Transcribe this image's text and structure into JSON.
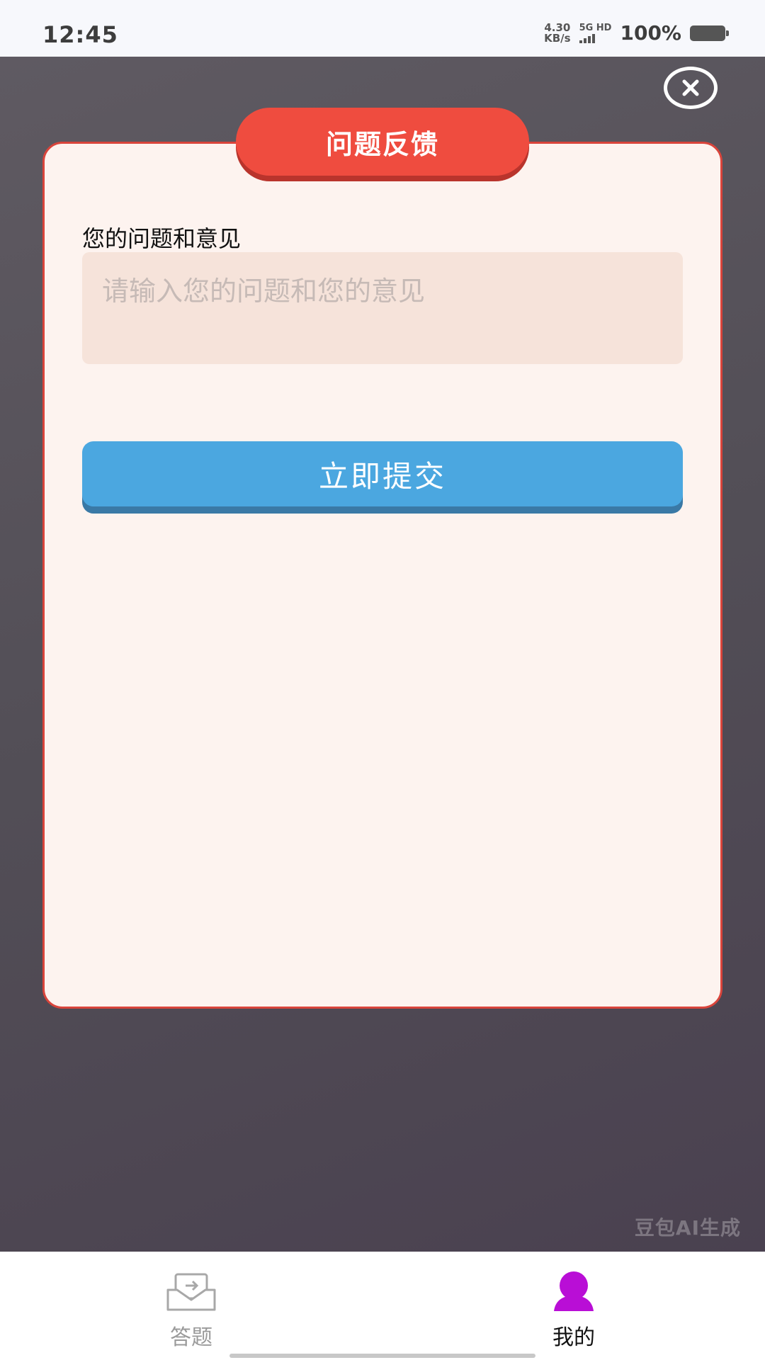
{
  "status_bar": {
    "time": "12:45",
    "speed_value": "4.30",
    "speed_unit": "KB/s",
    "network_top": "5G HD",
    "battery": "100%"
  },
  "dialog": {
    "title": "问题反馈",
    "field_label": "您的问题和意见",
    "input_placeholder": "请输入您的问题和您的意见",
    "input_value": "",
    "submit_label": "立即提交"
  },
  "watermark": "豆包AI生成",
  "tab_bar": {
    "items": [
      {
        "label": "答题",
        "icon": "mail-tray-icon",
        "active": false
      },
      {
        "label": "我的",
        "icon": "user-icon",
        "active": true
      }
    ]
  },
  "colors": {
    "title_tab": "#ef4c3f",
    "dialog_border": "#d9443b",
    "submit_button": "#4ba7e0",
    "active_tab_icon": "#b90ed6"
  }
}
